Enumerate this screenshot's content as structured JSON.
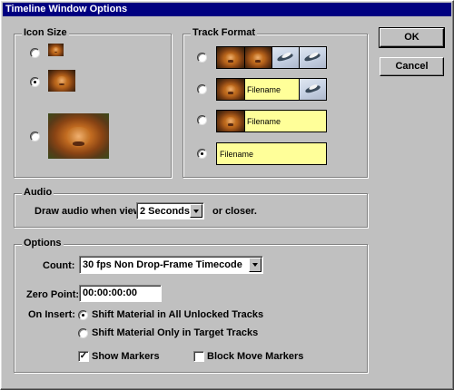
{
  "window": {
    "title": "Timeline Window Options"
  },
  "buttons": {
    "ok": "OK",
    "cancel": "Cancel"
  },
  "icon_size": {
    "label": "Icon Size",
    "selected_option": 2
  },
  "track_format": {
    "label": "Track Format",
    "selected_option": 4,
    "filename_text": "Filename"
  },
  "audio": {
    "label": "Audio",
    "prefix": "Draw audio when view",
    "value": "2 Seconds",
    "suffix": "or closer."
  },
  "options": {
    "label": "Options",
    "count_label": "Count:",
    "count_value": "30 fps Non Drop-Frame Timecode",
    "zero_point_label": "Zero Point:",
    "zero_point_value": "00:00:00:00",
    "on_insert_label": "On Insert:",
    "insert_all": "Shift Material in All Unlocked Tracks",
    "insert_target": "Shift Material Only in Target Tracks",
    "insert_selected": "all",
    "show_markers": "Show Markers",
    "show_markers_checked": true,
    "block_move_markers": "Block Move Markers",
    "block_move_markers_checked": false
  }
}
